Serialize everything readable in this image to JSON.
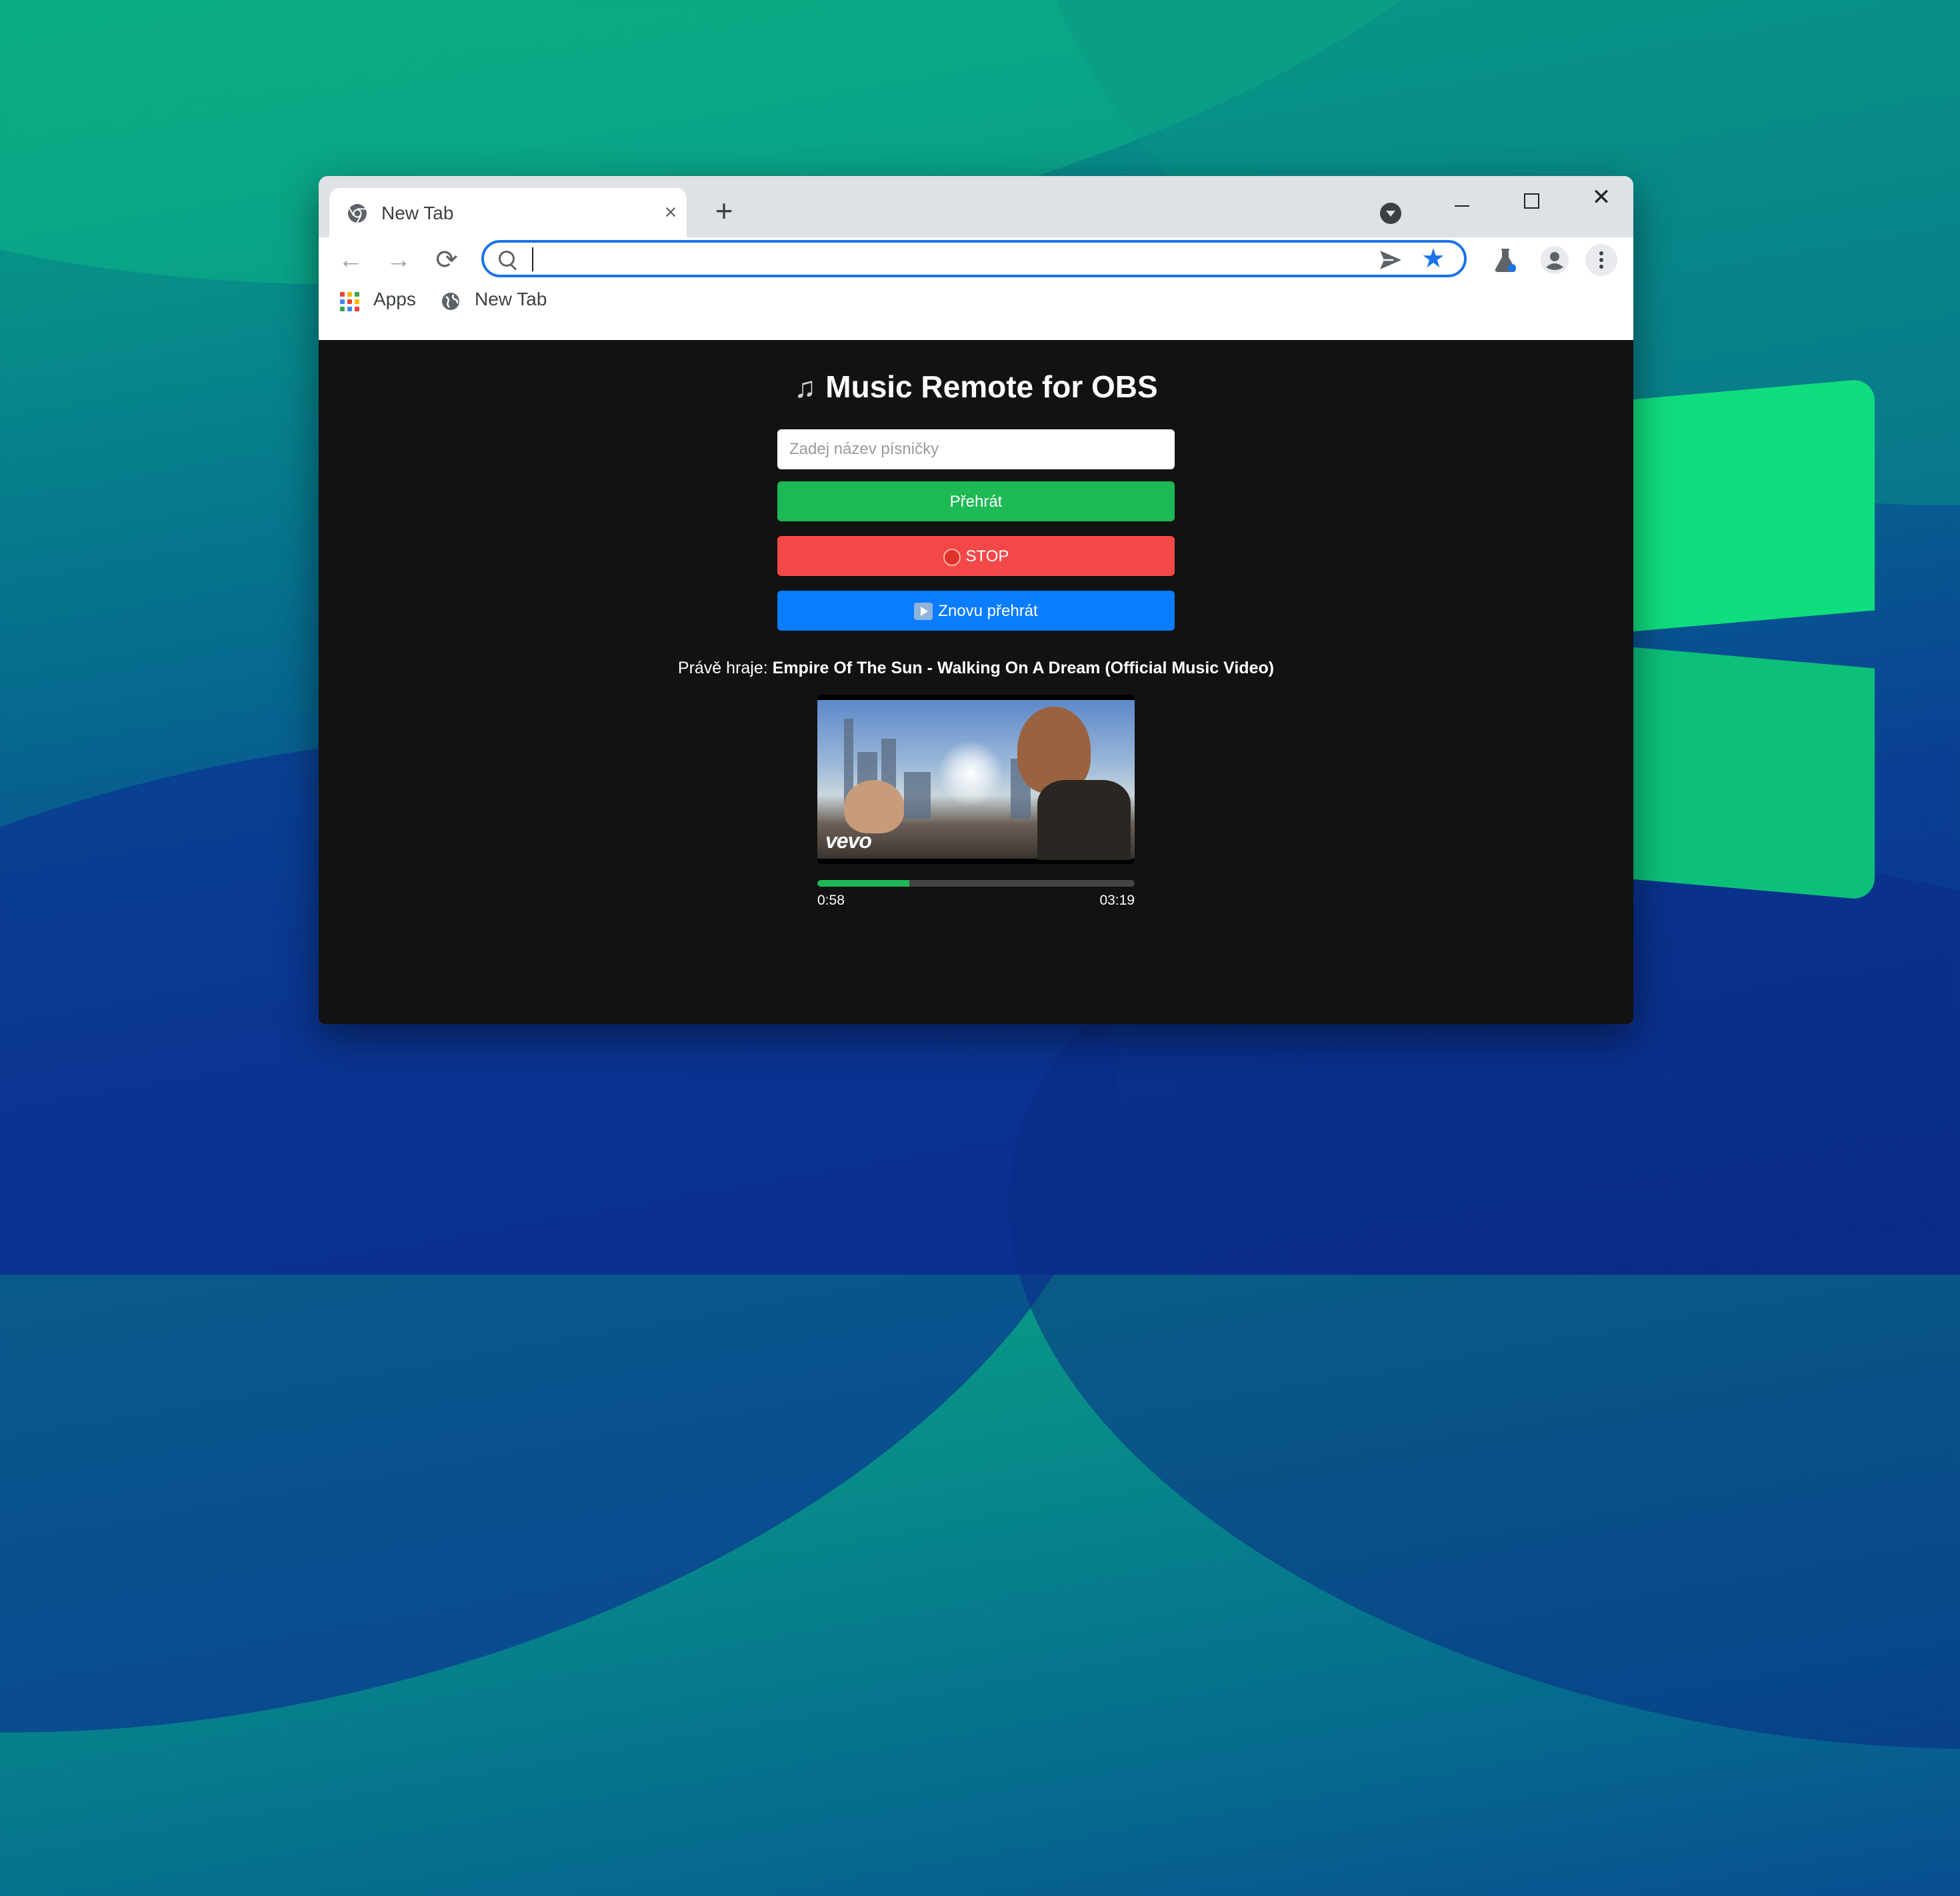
{
  "browser": {
    "tab": {
      "title": "New Tab",
      "close_label": "×"
    },
    "new_tab_label": "+",
    "window_controls": {
      "close_label": "✕"
    },
    "toolbar": {
      "back_label": "←",
      "forward_label": "→",
      "reload_label": "⟳",
      "address_value": "",
      "star_label": "★"
    },
    "bookmarks": [
      {
        "label": "Apps",
        "icon": "apps-grid-icon"
      },
      {
        "label": "New Tab",
        "icon": "globe-icon"
      }
    ]
  },
  "page": {
    "title_icon": "♫",
    "title": "Music Remote for OBS",
    "song_input": {
      "placeholder": "Zadej název písničky",
      "value": ""
    },
    "buttons": {
      "play": "Přehrát",
      "stop": "STOP",
      "replay": "Znovu přehrát"
    },
    "now_playing": {
      "label": "Právě hraje:",
      "song": "Empire Of The Sun - Walking On A Dream (Official Music Video)"
    },
    "thumbnail": {
      "watermark": "vevo"
    },
    "playback": {
      "current": "0:58",
      "total": "03:19",
      "progress_fraction": 0.29
    }
  },
  "colors": {
    "accent_blue": "#1a73e8",
    "play_green": "#1db954",
    "stop_red": "#f44848",
    "replay_blue": "#0a7cff",
    "page_bg": "#121212"
  }
}
